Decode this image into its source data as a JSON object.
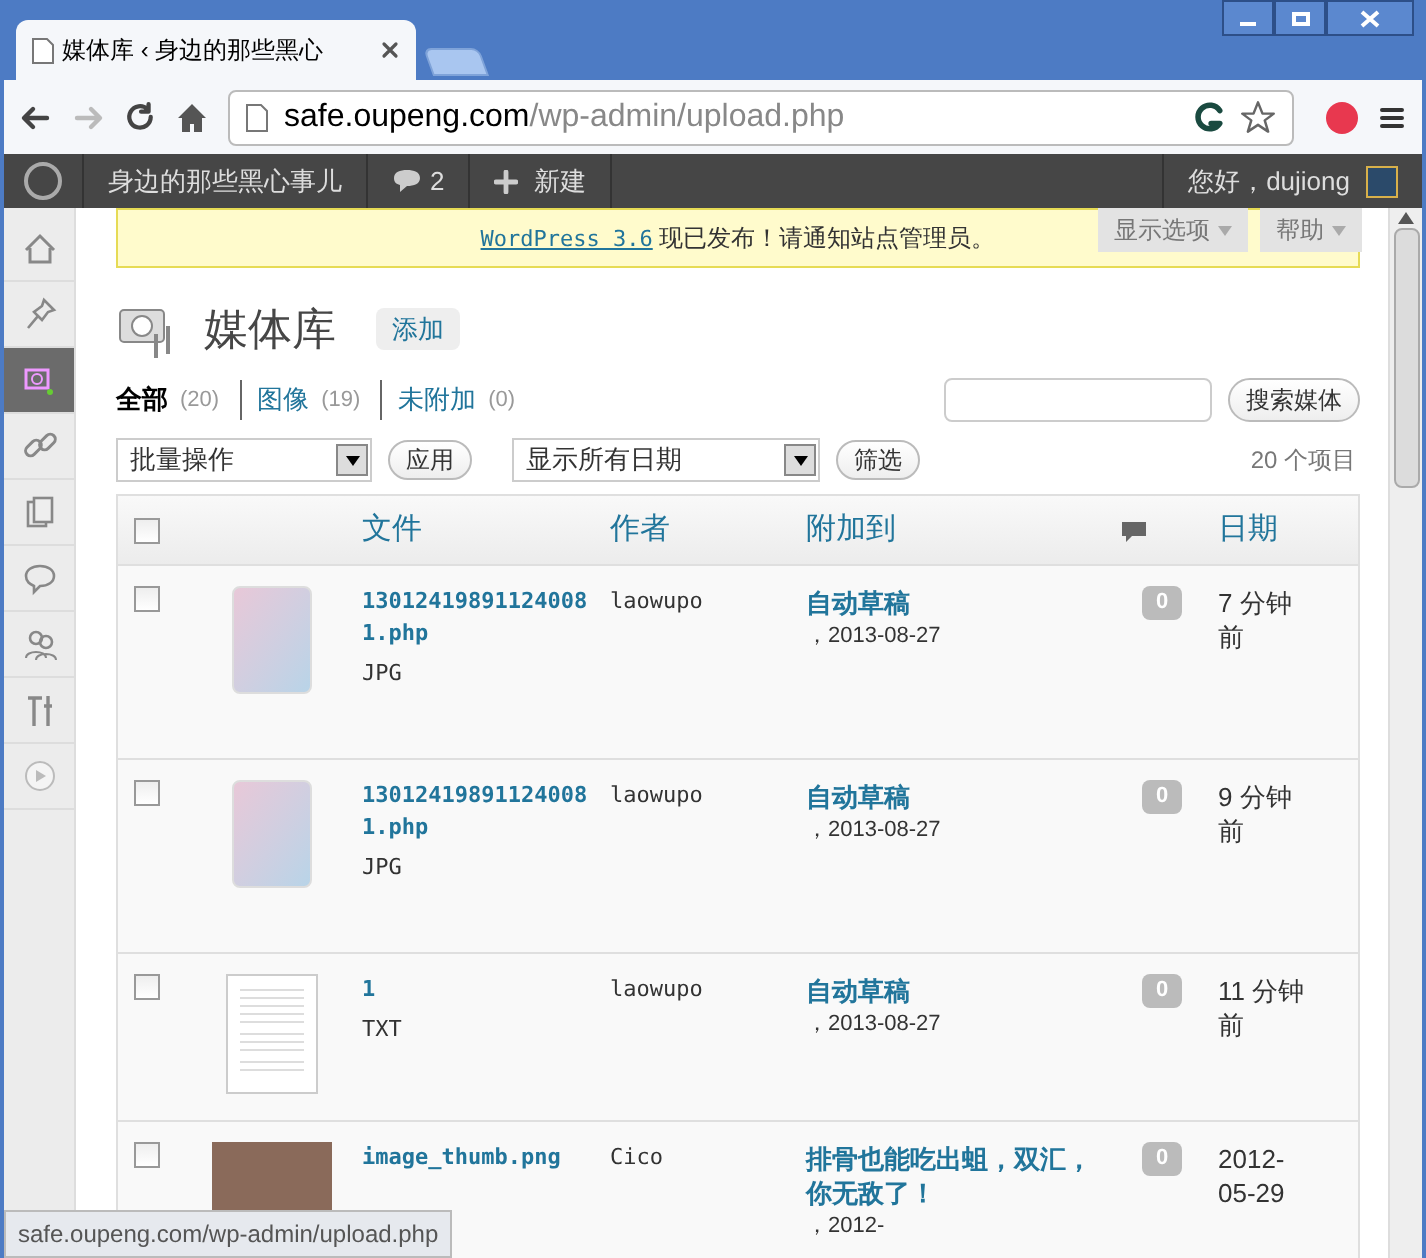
{
  "browser": {
    "tab_title": "媒体库 ‹ 身边的那些黑心",
    "url_host": "safe.oupeng.com",
    "url_path": "/wp-admin/upload.php",
    "status_url": "safe.oupeng.com/wp-admin/upload.php"
  },
  "admin_bar": {
    "site_name": "身边的那些黑心事儿",
    "comments": "2",
    "new": "新建",
    "greeting": "您好，dujiong"
  },
  "notice": {
    "link": "WordPress 3.6",
    "text": " 现已发布！请通知站点管理员。"
  },
  "screen_tabs": [
    "显示选项",
    "帮助"
  ],
  "sidebar": {
    "items": [
      {
        "selected": false
      },
      {
        "selected": false
      },
      {
        "selected": true
      },
      {
        "selected": false
      },
      {
        "selected": false
      },
      {
        "selected": false
      },
      {
        "selected": false
      },
      {
        "selected": false
      },
      {
        "selected": false
      }
    ]
  },
  "page": {
    "title": "媒体库",
    "add": "添加"
  },
  "filters": [
    {
      "label": "全部",
      "count": "(20)",
      "selected": true
    },
    {
      "label": "图像",
      "count": "(19)",
      "selected": false
    },
    {
      "label": "未附加",
      "count": "(0)",
      "selected": false
    }
  ],
  "search": {
    "button": "搜索媒体"
  },
  "actions": {
    "bulk": "批量操作",
    "apply": "应用",
    "dates": "显示所有日期",
    "filter": "筛选",
    "count": "20 个项目"
  },
  "table": {
    "columns": [
      "文件",
      "作者",
      "附加到",
      "日期"
    ],
    "header_checked": false,
    "rows": [
      {
        "kind": "card",
        "file": "130124198911240081.php",
        "type": "JPG",
        "author": "laowupo",
        "attached": "自动草稿",
        "attached_date": "，2013-08-27",
        "comments": "0",
        "date": "7 分钟前",
        "checked": false
      },
      {
        "kind": "card",
        "file": "130124198911240081.php",
        "type": "JPG",
        "author": "laowupo",
        "attached": "自动草稿",
        "attached_date": "，2013-08-27",
        "comments": "0",
        "date": "9 分钟前",
        "checked": false
      },
      {
        "kind": "document",
        "file": "1",
        "type": "TXT",
        "author": "laowupo",
        "attached": "自动草稿",
        "attached_date": "，2013-08-27",
        "comments": "0",
        "date": "11 分钟前",
        "checked": false
      },
      {
        "kind": "photo",
        "file": "image_thumb.png",
        "author": "Cico",
        "attached": "排骨也能吃出蛆，双汇，你无敌了！",
        "attached_date": "，2012-",
        "comments": "0",
        "date": "2012-05-29",
        "checked": false
      }
    ]
  }
}
